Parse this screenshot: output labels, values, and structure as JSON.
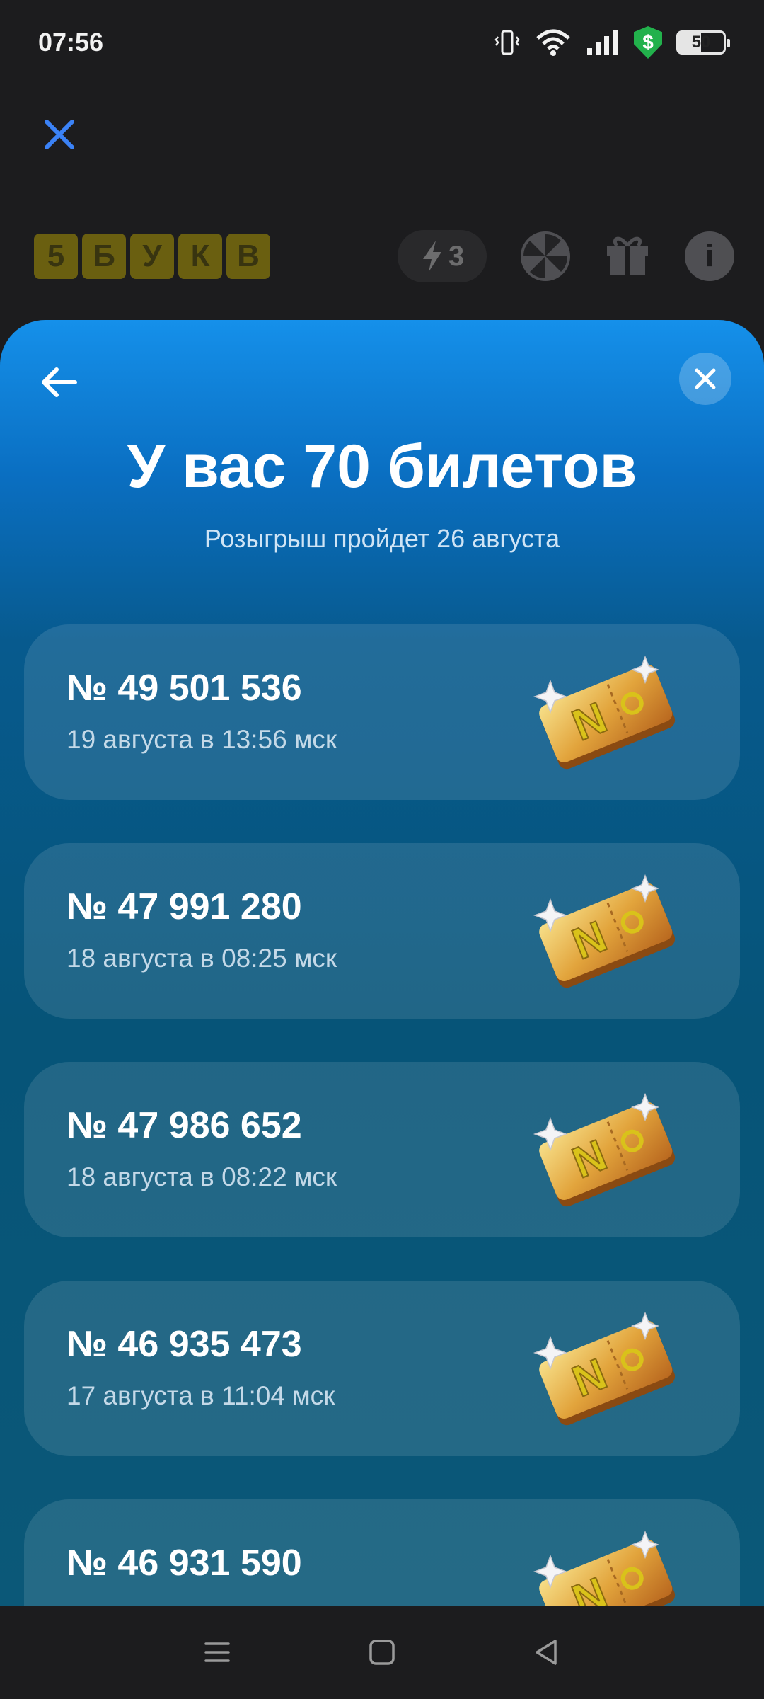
{
  "status_bar": {
    "time": "07:56",
    "battery": "50",
    "shield_symbol": "$"
  },
  "game": {
    "logo_letters": [
      "5",
      "Б",
      "У",
      "К",
      "В"
    ],
    "energy_count": "3",
    "info_symbol": "i"
  },
  "sheet": {
    "title": "У вас 70 билетов",
    "subtitle": "Розыгрыш пройдет 26 августа",
    "tickets": [
      {
        "number": "№ 49 501 536",
        "date": "19 августа в 13:56 мск"
      },
      {
        "number": "№ 47 991 280",
        "date": "18 августа в 08:25 мск"
      },
      {
        "number": "№ 47 986 652",
        "date": "18 августа в 08:22 мск"
      },
      {
        "number": "№ 46 935 473",
        "date": "17 августа в 11:04 мск"
      },
      {
        "number": "№ 46 931 590",
        "date": ""
      }
    ]
  },
  "colors": {
    "accent_blue": "#3b82f6",
    "logo_yellow": "#c9b200",
    "sheet_top": "#1590ea",
    "sheet_bottom": "#065478"
  },
  "icons": {
    "status": [
      "vibrate-icon",
      "wifi-icon",
      "signal-icon",
      "shield-dollar-icon",
      "battery-icon"
    ],
    "header": [
      "lightning-icon",
      "wheel-icon",
      "gift-icon",
      "info-icon"
    ],
    "nav": [
      "menu-icon",
      "home-icon",
      "back-triangle-icon"
    ]
  }
}
